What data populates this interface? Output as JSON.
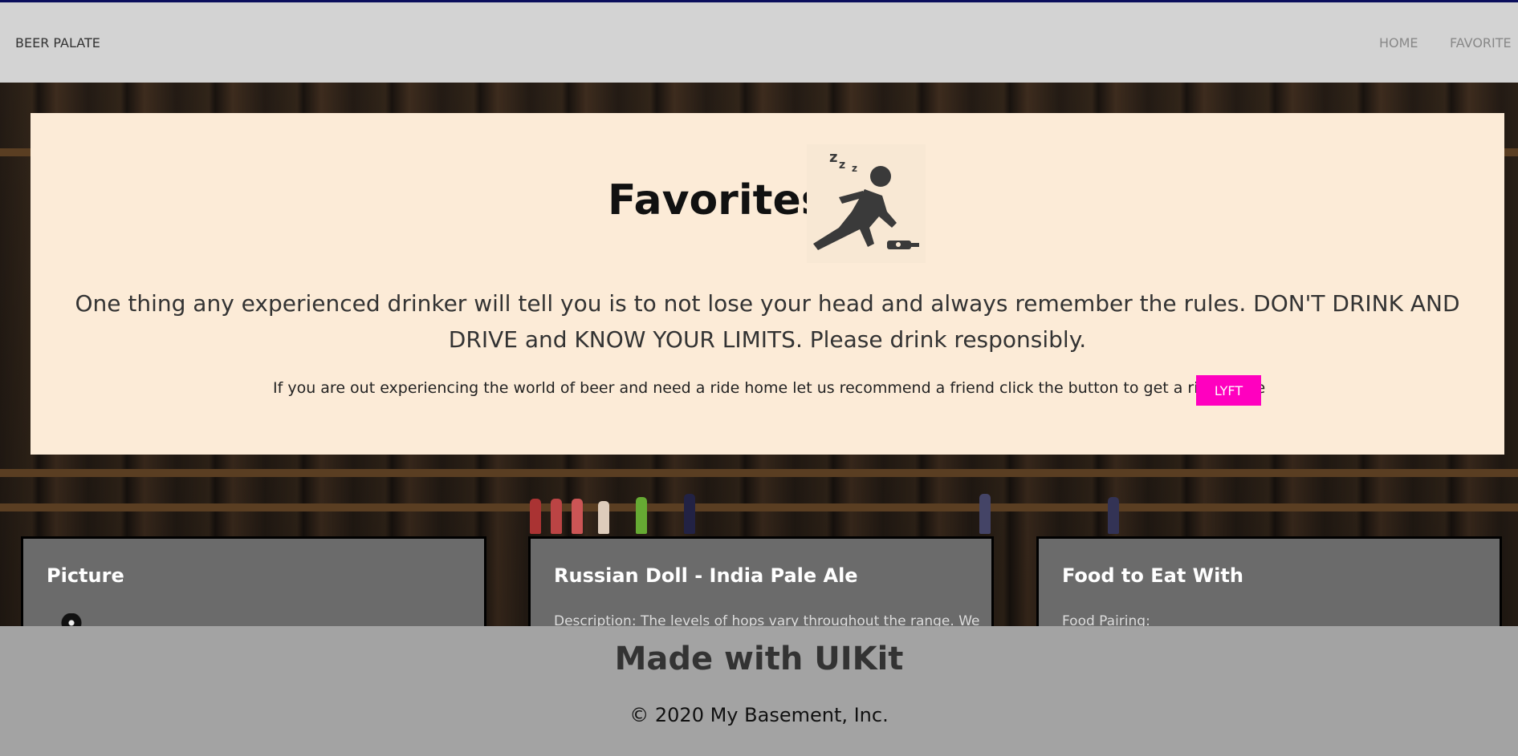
{
  "navbar": {
    "brand": "BEER PALATE",
    "links": [
      {
        "label": "HOME"
      },
      {
        "label": "FAVORITE"
      }
    ]
  },
  "hero": {
    "title": "Favorites",
    "icon": "drunk-person-icon",
    "lead": "One thing any experienced drinker will tell you is to not lose your head and always remember the rules. DON'T DRINK AND DRIVE and KNOW YOUR LIMITS. Please drink responsibly.",
    "ride_text": "If you are out experiencing the world of beer and need a ride home let us recommend a friend click the button to get a ride home",
    "button_label": "LYFT"
  },
  "cards": [
    {
      "title": "Picture",
      "text": ""
    },
    {
      "title": "Russian Doll - India Pale Ale",
      "text": "Description: The levels of hops vary throughout the range. We"
    },
    {
      "title": "Food to Eat With",
      "text": "Food Pairing:"
    }
  ],
  "footer": {
    "title": "Made with UIKit",
    "copyright": "© 2020 My Basement, Inc."
  },
  "colors": {
    "navbar_bg": "#d3d3d3",
    "hero_bg": "#fcebd7",
    "lyft_button": "#ff00bf",
    "card_bg": "#6b6b6b",
    "footer_bg": "#a3a3a3"
  }
}
